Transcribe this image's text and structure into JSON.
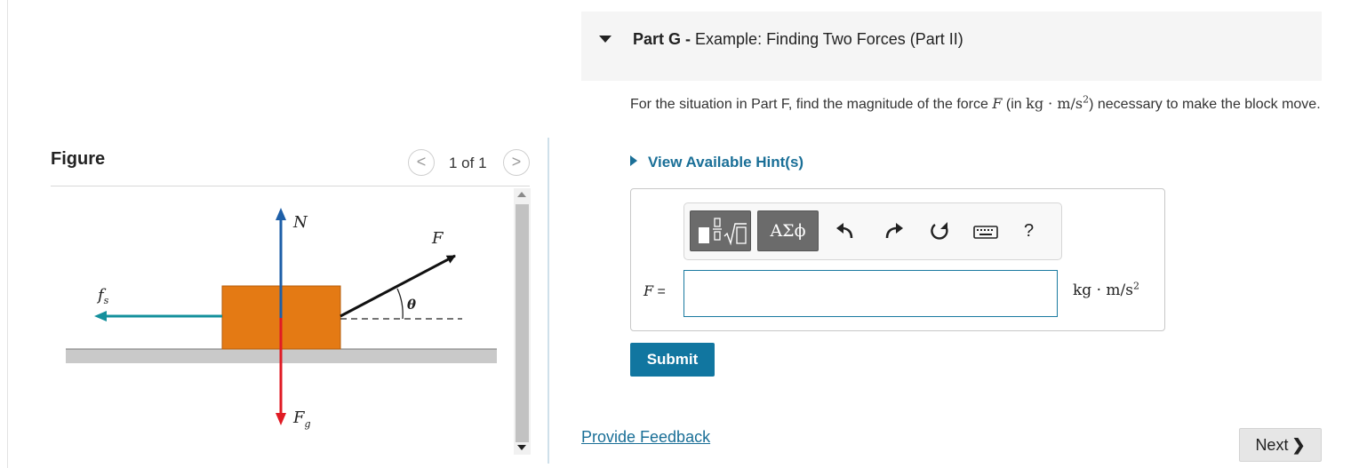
{
  "figure_panel": {
    "title": "Figure",
    "pager_text": "1 of 1",
    "prev_glyph": "<",
    "next_glyph": ">",
    "diagram": {
      "labels": {
        "normal": "N",
        "applied": "F",
        "angle": "θ",
        "friction": "f",
        "friction_sub": "s",
        "gravity": "F",
        "gravity_sub": "g"
      },
      "colors": {
        "block": "#e47a14",
        "normal_arrow": "#1e5fa8",
        "gravity_arrow": "#e01b24",
        "friction_arrow": "#14909c",
        "applied_arrow": "#111111",
        "ground": "#c9c9c9"
      }
    }
  },
  "question": {
    "part_label": "Part G",
    "separator": " - ",
    "part_title": "Example: Finding Two Forces (Part II)",
    "prompt_before": "For the situation in Part F, find the magnitude of the force ",
    "prompt_symbol": "F",
    "prompt_unit_open": " (in ",
    "prompt_unit": "kg · m/s",
    "prompt_unit_exp": "2",
    "prompt_after": ") necessary to make the block move.",
    "hint_link": "View Available Hint(s)",
    "answer": {
      "variable_label": "F",
      "equals": " =",
      "value": "",
      "unit": "kg · m/s",
      "unit_exp": "2"
    },
    "toolbar": {
      "greek_label": "ΑΣϕ",
      "help_label": "?",
      "icons": [
        "templates-icon",
        "greek-letters-icon",
        "undo-icon",
        "redo-icon",
        "reset-icon",
        "keyboard-icon",
        "help-icon"
      ]
    },
    "submit_label": "Submit",
    "feedback_link": "Provide Feedback",
    "next_label": "Next",
    "next_glyph": "❯",
    "accent_color": "#1176a0"
  }
}
